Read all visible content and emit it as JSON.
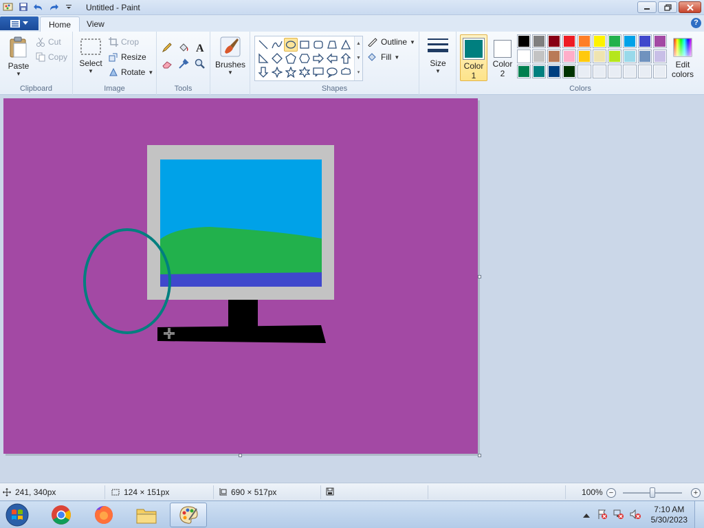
{
  "window": {
    "title": "Untitled - Paint"
  },
  "tabs": [
    {
      "label": "Home"
    },
    {
      "label": "View"
    }
  ],
  "clipboard": {
    "paste": "Paste",
    "cut": "Cut",
    "copy": "Copy",
    "group": "Clipboard"
  },
  "image": {
    "select": "Select",
    "crop": "Crop",
    "resize": "Resize",
    "rotate": "Rotate",
    "group": "Image"
  },
  "tools": {
    "group": "Tools"
  },
  "brushes": {
    "label": "Brushes"
  },
  "shapes": {
    "outline": "Outline",
    "fill": "Fill",
    "group": "Shapes"
  },
  "size": {
    "label": "Size"
  },
  "colors": {
    "color1_line1": "Color",
    "color1_line2": "1",
    "color2_line1": "Color",
    "color2_line2": "2",
    "edit_line1": "Edit",
    "edit_line2": "colors",
    "group": "Colors",
    "color1": "#007f7f",
    "color2": "#ffffff",
    "palette": [
      "#000000",
      "#7f7f7f",
      "#880015",
      "#ed1c24",
      "#ff7f27",
      "#fff200",
      "#22b14c",
      "#00a2e8",
      "#3f48cc",
      "#a349a4",
      "#ffffff",
      "#c3c3c3",
      "#b97a57",
      "#ffaec9",
      "#ffc90e",
      "#efe4b0",
      "#b5e61d",
      "#99d9ea",
      "#7092be",
      "#c8bfe7",
      "#007f4f",
      "#007f7f",
      "#004080",
      "#003300",
      "#e8edf4",
      "#e8edf4",
      "#e8edf4",
      "#e8edf4",
      "#e8edf4",
      "#e8edf4"
    ]
  },
  "canvas_colors": {
    "background": "#a349a4",
    "frame": "#c3c3c3",
    "sky": "#00a2e8",
    "grass": "#22b14c",
    "water": "#3f48cc",
    "stand": "#000000",
    "ellipse": "#007f7f"
  },
  "status": {
    "cursor": "241, 340px",
    "selection": "124 × 151px",
    "canvas_size": "690 × 517px",
    "zoom": "100%"
  },
  "taskbar": {
    "time": "7:10 AM",
    "date": "5/30/2023"
  }
}
